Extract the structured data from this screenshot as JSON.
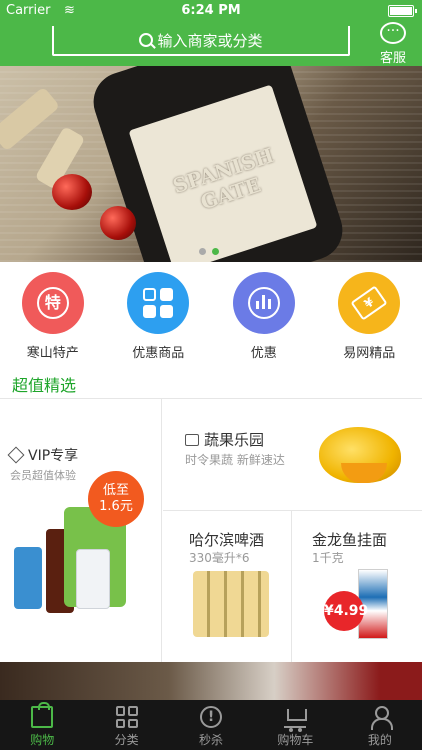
{
  "status_bar": {
    "carrier": "Carrier",
    "time": "6:24 PM"
  },
  "header": {
    "search_placeholder": "输入商家或分类",
    "service_label": "客服"
  },
  "banner": {
    "bottle_label": "SPANISH GATE"
  },
  "categories": [
    {
      "label": "寒山特产",
      "icon": "te-badge-icon",
      "icon_text": "特",
      "color": "#f05a5a"
    },
    {
      "label": "优惠商品",
      "icon": "grid-icon",
      "color": "#2d9ff0"
    },
    {
      "label": "优惠",
      "icon": "chart-bars-icon",
      "color": "#6b7be6"
    },
    {
      "label": "易网精品",
      "icon": "price-tag-icon",
      "icon_text": "¥",
      "color": "#f6b51b"
    }
  ],
  "section_title": "超值精选",
  "deals": {
    "vip": {
      "title": "VIP专享",
      "subtitle": "会员超值体验",
      "badge_top": "低至",
      "badge_price": "1.6元"
    },
    "fruit": {
      "title": "蔬果乐园",
      "subtitle": "时令果蔬 新鲜速达"
    },
    "beer": {
      "title": "哈尔滨啤酒",
      "subtitle": "330毫升*6"
    },
    "noodle": {
      "title": "金龙鱼挂面",
      "subtitle": "1千克",
      "price": "¥4.99"
    }
  },
  "tabbar": [
    {
      "label": "购物",
      "active": true
    },
    {
      "label": "分类",
      "active": false
    },
    {
      "label": "秒杀",
      "active": false
    },
    {
      "label": "购物车",
      "active": false
    },
    {
      "label": "我的",
      "active": false
    }
  ],
  "colors": {
    "brand_green": "#4cb848",
    "section_green": "#1ea52a",
    "tabbar_bg": "#161616"
  }
}
